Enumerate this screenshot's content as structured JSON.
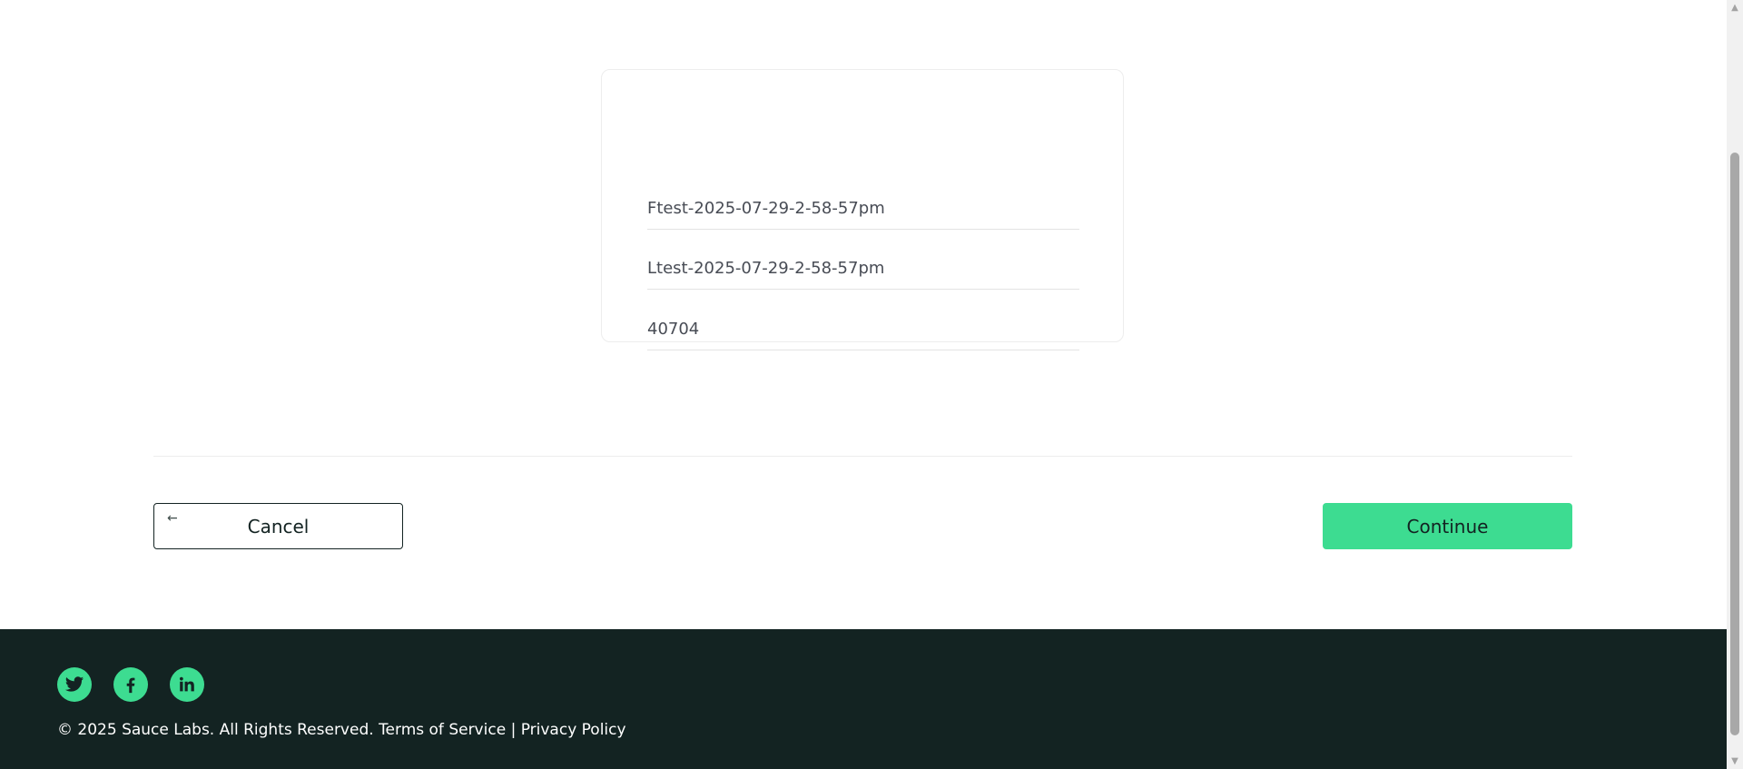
{
  "form": {
    "first_name": "Ftest-2025-07-29-2-58-57pm",
    "last_name": "Ltest-2025-07-29-2-58-57pm",
    "postal_code": "40704"
  },
  "actions": {
    "cancel_label": "Cancel",
    "cancel_icon": "arrow-left-icon",
    "continue_label": "Continue"
  },
  "footer": {
    "social": [
      "twitter-icon",
      "facebook-icon",
      "linkedin-icon"
    ],
    "copyright": "© 2025 Sauce Labs. All Rights Reserved.",
    "terms": "Terms of Service",
    "separator": "|",
    "privacy": "Privacy Policy"
  },
  "colors": {
    "accent": "#3ddc91",
    "footer_bg": "#132322"
  }
}
